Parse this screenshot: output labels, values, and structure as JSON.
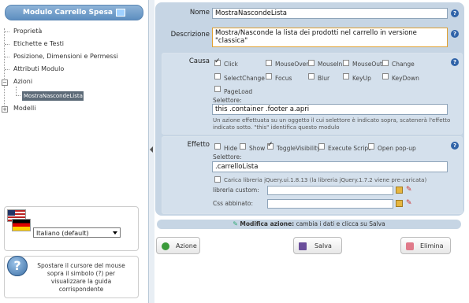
{
  "sidebar": {
    "title": "Modulo Carrello Spesa",
    "items": [
      {
        "label": "Proprietà"
      },
      {
        "label": "Etichette e Testi"
      },
      {
        "label": "Posizione, Dimensioni e Permessi"
      },
      {
        "label": "Attributi Modulo"
      },
      {
        "label": "Azioni"
      },
      {
        "label": "MostraNascondeLista"
      },
      {
        "label": "Modelli"
      }
    ],
    "language_select": "Italiano (default)",
    "help_text": "Spostare il cursore del mouse sopra il simbolo (?) per visualizzare la guida corrispondente"
  },
  "form": {
    "name_label": "Nome",
    "name_value": "MostraNascondeLista",
    "desc_label": "Descrizione",
    "desc_value": "Mostra/Nasconde la lista dei prodotti nel carrello in versione \"classica\"",
    "cause_label": "Causa",
    "cause_options": [
      "Click",
      "MouseOver",
      "MouseIn",
      "MouseOut",
      "Change",
      "SelectChange",
      "Focus",
      "Blur",
      "KeyUp",
      "KeyDown",
      "PageLoad"
    ],
    "cause_checked": "Click",
    "selector_label": "Selettore:",
    "cause_selector": "this .container .footer a.apri",
    "cause_note": "Un azione effettuata su un oggetto il cui selettore è indicato sopra, scatenerà l'effetto indicato sotto. \"this\" identifica questo modulo",
    "effect_label": "Effetto",
    "effect_options": [
      "Hide",
      "Show",
      "ToggleVisibility",
      "Execute Script",
      "Open pop-up"
    ],
    "effect_checked": "ToggleVisibility",
    "effect_selector": ".carrelloLista",
    "jquery_ui": "Carica libreria jQuery.ui.1.8.13 (la libreria jQuery.1.7.2 viene pre-caricata)",
    "custom_lib_label": "libreria custom:",
    "css_label": "Css abbinato:",
    "help": "?"
  },
  "status": {
    "bold": "Modifica azione:",
    "text": " cambia i dati e clicca su Salva"
  },
  "buttons": {
    "add": "Azione",
    "save": "Salva",
    "delete": "Elimina"
  },
  "colors": {
    "panel": "#c6d5e4",
    "header": "#5d8ec0",
    "selected": "#5d6b78"
  }
}
